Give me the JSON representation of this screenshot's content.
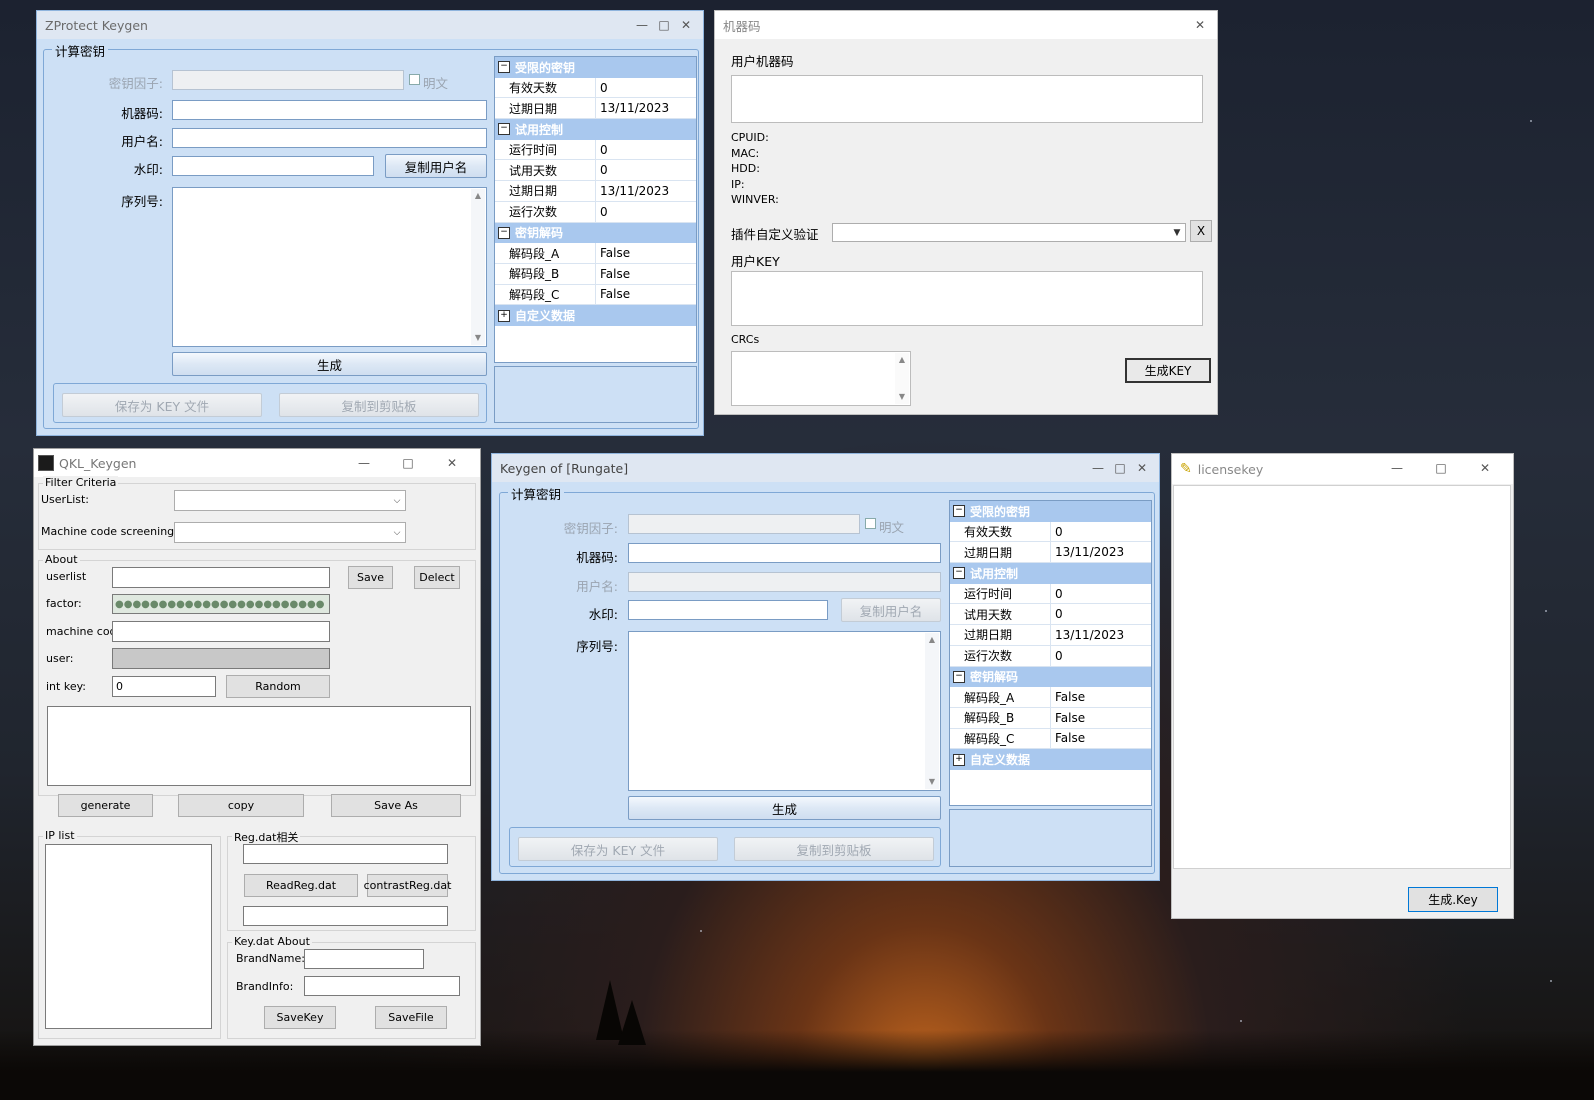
{
  "zprotect": {
    "title": "ZProtect Keygen",
    "group_title": "计算密钥",
    "key_factor_label": "密钥因子:",
    "plaintext_label": "明文",
    "machine_code_label": "机器码:",
    "username_label": "用户名:",
    "watermark_label": "水印:",
    "copy_username_btn": "复制用户名",
    "serial_label": "序列号:",
    "generate_btn": "生成",
    "save_key_btn": "保存为 KEY 文件",
    "copy_clip_btn": "复制到剪贴板",
    "grid": [
      {
        "cat": "受限的密钥",
        "rows": [
          [
            "有效天数",
            "0"
          ],
          [
            "过期日期",
            "13/11/2023"
          ]
        ]
      },
      {
        "cat": "试用控制",
        "rows": [
          [
            "运行时间",
            "0"
          ],
          [
            "试用天数",
            "0"
          ],
          [
            "过期日期",
            "13/11/2023"
          ],
          [
            "运行次数",
            "0"
          ]
        ]
      },
      {
        "cat": "密钥解码",
        "rows": [
          [
            "解码段_A",
            "False"
          ],
          [
            "解码段_B",
            "False"
          ],
          [
            "解码段_C",
            "False"
          ]
        ]
      },
      {
        "cat": "自定义数据",
        "collapsed": true,
        "rows": []
      }
    ]
  },
  "machine": {
    "title": "机器码",
    "user_machine_code_label": "用户机器码",
    "cpuid_label": "CPUID:",
    "mac_label": "MAC:",
    "hdd_label": "HDD:",
    "ip_label": "IP:",
    "winver_label": "WINVER:",
    "plugin_label": "插件自定义验证",
    "clear_btn": "X",
    "user_key_label": "用户KEY",
    "crcs_label": "CRCs",
    "generate_key_btn": "生成KEY"
  },
  "qkl": {
    "title": "QKL_Keygen",
    "filter_legend": "Filter Criteria",
    "userlist_label": "UserList:",
    "machine_screening_label": "Machine code screening:",
    "about_legend": "About",
    "userlist_field_label": "userlist",
    "save_btn": "Save",
    "delect_btn": "Delect",
    "factor_label": "factor:",
    "factor_value": "●●●●●●●●●●●●●●●●●●●●●●●●",
    "machine_cod_label": "machine cod",
    "user_label": "user:",
    "int_key_label": "int key:",
    "int_key_value": "0",
    "random_btn": "Random",
    "generate_btn": "generate",
    "copy_btn": "copy",
    "save_as_btn": "Save As",
    "ip_list_legend": "IP list",
    "reg_legend": "Reg.dat相关",
    "read_reg_btn": "ReadReg.dat",
    "contrast_reg_btn": "contrastReg.dat",
    "keydat_legend": "Key.dat About",
    "brandname_label": "BrandName:",
    "brandinfo_label": "BrandInfo:",
    "savekey_btn": "SaveKey",
    "savefile_btn": "SaveFile"
  },
  "rungate": {
    "title": "Keygen of [Rungate]",
    "group_title": "计算密钥",
    "key_factor_label": "密钥因子:",
    "plaintext_label": "明文",
    "machine_code_label": "机器码:",
    "username_label": "用户名:",
    "watermark_label": "水印:",
    "copy_username_btn": "复制用户名",
    "serial_label": "序列号:",
    "generate_btn": "生成",
    "save_key_btn": "保存为 KEY 文件",
    "copy_clip_btn": "复制到剪贴板",
    "grid": [
      {
        "cat": "受限的密钥",
        "rows": [
          [
            "有效天数",
            "0"
          ],
          [
            "过期日期",
            "13/11/2023"
          ]
        ]
      },
      {
        "cat": "试用控制",
        "rows": [
          [
            "运行时间",
            "0"
          ],
          [
            "试用天数",
            "0"
          ],
          [
            "过期日期",
            "13/11/2023"
          ],
          [
            "运行次数",
            "0"
          ]
        ]
      },
      {
        "cat": "密钥解码",
        "rows": [
          [
            "解码段_A",
            "False"
          ],
          [
            "解码段_B",
            "False"
          ],
          [
            "解码段_C",
            "False"
          ]
        ]
      },
      {
        "cat": "自定义数据",
        "collapsed": true,
        "rows": []
      }
    ]
  },
  "license": {
    "title": "licensekey",
    "generate_key_btn": "生成.Key"
  },
  "window_controls": {
    "minimize": "—",
    "maximize": "□",
    "close": "✕"
  }
}
